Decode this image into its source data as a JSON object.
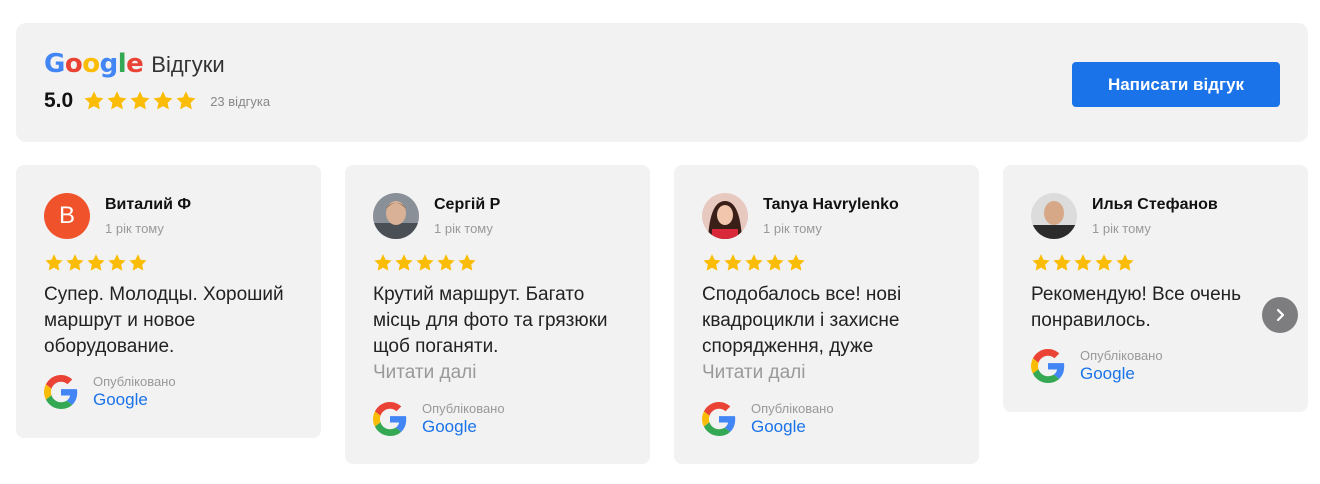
{
  "header": {
    "brand_letters": [
      "G",
      "o",
      "o",
      "g",
      "l",
      "e"
    ],
    "title": "Відгуки",
    "rating": "5.0",
    "review_count": "23 відгука",
    "write_review_button": "Написати відгук"
  },
  "reviews": [
    {
      "name": "Виталий Ф",
      "avatar_letter": "В",
      "time": "1 рік тому",
      "stars": 5,
      "text": "Супер. Молодцы. Хороший маршрут и новое оборудование.",
      "read_more": "",
      "published_label": "Опубліковано",
      "published_source": "Google"
    },
    {
      "name": "Сергій Р",
      "time": "1 рік тому",
      "stars": 5,
      "text": "Крутий маршрут. Багато місць для фото та грязюки щоб поганяти.",
      "read_more": "Читати далі",
      "published_label": "Опубліковано",
      "published_source": "Google"
    },
    {
      "name": "Tanya Havrylenko",
      "time": "1 рік тому",
      "stars": 5,
      "text": "Сподобалось все! нові квадроцикли і захисне спорядження, дуже",
      "read_more": "Читати далі",
      "published_label": "Опубліковано",
      "published_source": "Google"
    },
    {
      "name": "Илья Стефанов",
      "time": "1 рік тому",
      "stars": 5,
      "text": "Рекомендую! Все очень понравилось.",
      "read_more": "",
      "published_label": "Опубліковано",
      "published_source": "Google"
    }
  ],
  "colors": {
    "star": "#fbbc05",
    "accent": "#1a73e8",
    "card_bg": "#f2f2f3",
    "google_blue": "#4285f4",
    "google_red": "#ea4335",
    "google_yellow": "#fbbc05",
    "google_green": "#34a853"
  },
  "icons": {
    "star": "star-icon",
    "google": "google-g-icon",
    "next": "chevron-right-icon"
  }
}
